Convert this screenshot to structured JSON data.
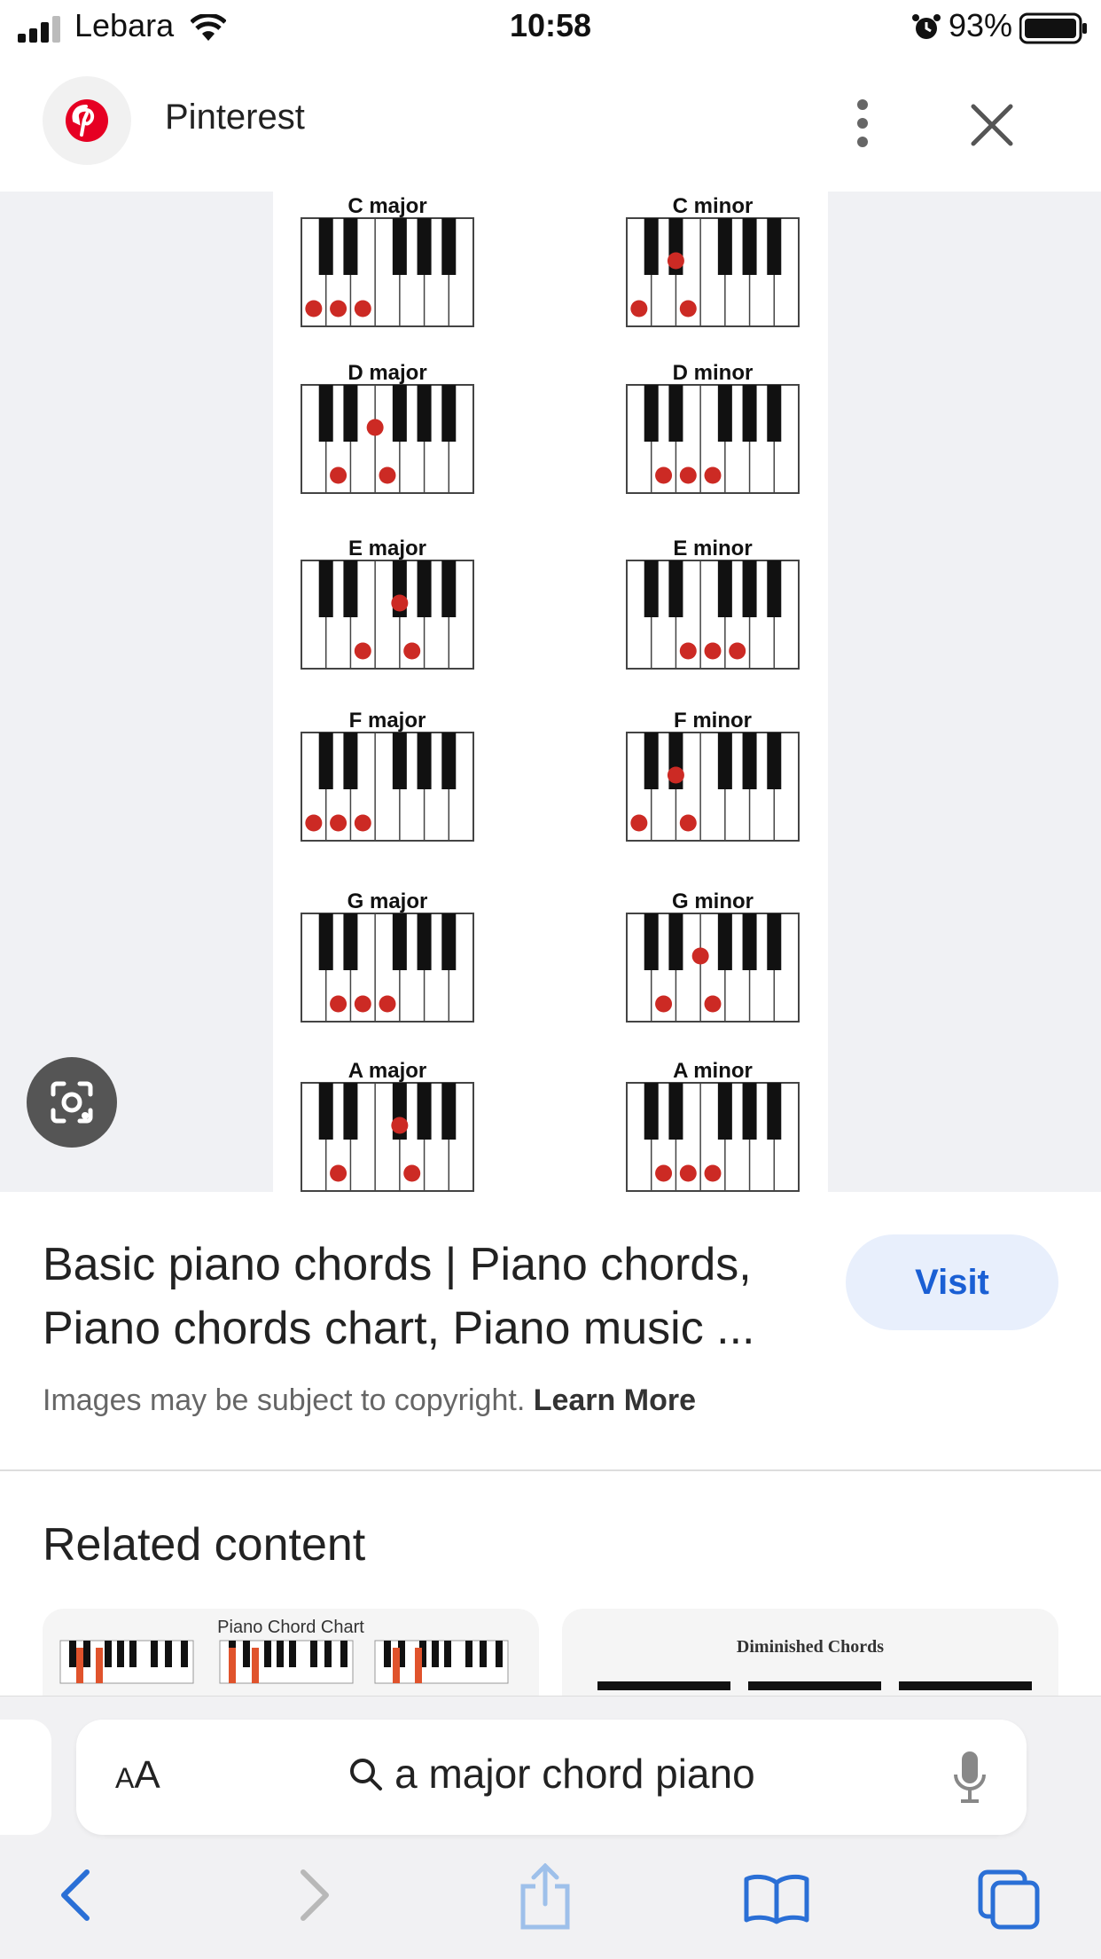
{
  "status_bar": {
    "carrier": "Lebara",
    "time": "10:58",
    "battery": "93%"
  },
  "header": {
    "title": "Pinterest"
  },
  "chart_data": {
    "type": "table",
    "title": "",
    "chords": [
      {
        "label": "C major",
        "white_dots": [
          0,
          1,
          2
        ],
        "black_dots": []
      },
      {
        "label": "C minor",
        "white_dots": [
          0,
          2
        ],
        "black_dots": [
          1
        ]
      },
      {
        "label": "D major",
        "white_dots": [
          1,
          3
        ],
        "black_dots": [
          2
        ]
      },
      {
        "label": "D minor",
        "white_dots": [
          1,
          2,
          3
        ],
        "black_dots": []
      },
      {
        "label": "E major",
        "white_dots": [
          2,
          4
        ],
        "black_dots": [
          3
        ]
      },
      {
        "label": "E minor",
        "white_dots": [
          2,
          3,
          4
        ],
        "black_dots": []
      },
      {
        "label": "F major",
        "white_dots": [
          0,
          1,
          2
        ],
        "black_dots": []
      },
      {
        "label": "F minor",
        "white_dots": [
          0,
          2
        ],
        "black_dots": [
          1
        ]
      },
      {
        "label": "G major",
        "white_dots": [
          1,
          2,
          3
        ],
        "black_dots": []
      },
      {
        "label": "G minor",
        "white_dots": [
          1,
          3
        ],
        "black_dots": [
          2
        ]
      },
      {
        "label": "A major",
        "white_dots": [
          1,
          4
        ],
        "black_dots": [
          3
        ]
      },
      {
        "label": "A minor",
        "white_dots": [
          1,
          2,
          3
        ],
        "black_dots": []
      }
    ]
  },
  "result": {
    "title": "Basic piano chords | Piano chords, Piano chords chart, Piano music ...",
    "visit_label": "Visit",
    "copyright_text": "Images may be subject to copyright.",
    "learn_more": "Learn More"
  },
  "related": {
    "heading": "Related content",
    "cards": [
      {
        "label": "Piano Chord Chart"
      },
      {
        "label": "Diminished Chords"
      }
    ]
  },
  "browser": {
    "aa_label": "AA",
    "url_text": "a major chord piano"
  },
  "colors": {
    "accent": "#1a5fd4",
    "dot": "#cc2a24",
    "pinterest": "#e60023"
  }
}
